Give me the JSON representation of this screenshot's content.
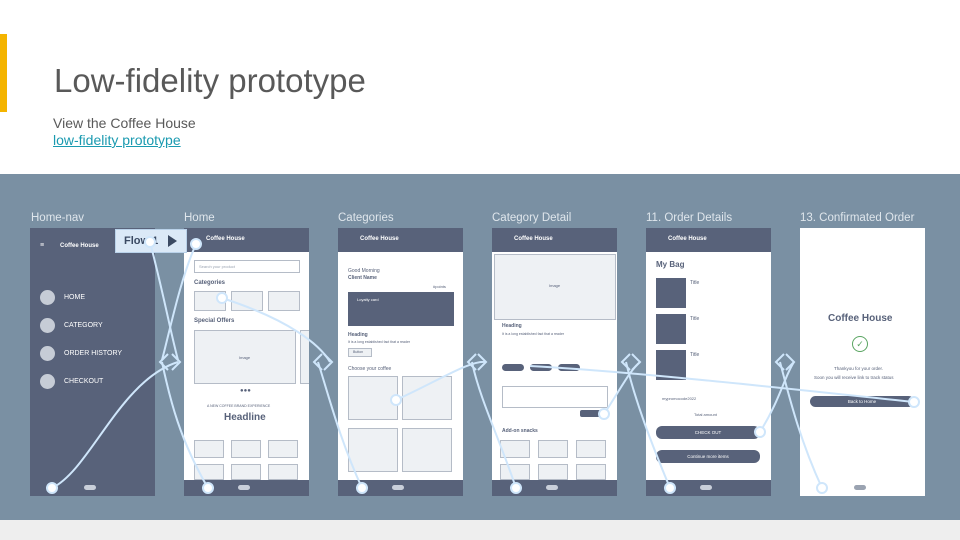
{
  "slide": {
    "title": "Low-fidelity prototype",
    "subtitle_line1": "View the Coffee House",
    "subtitle_link": "low-fidelity prototype",
    "accent_color": "#f4b400",
    "band_color": "#7a90a3",
    "link_color": "#1a9ab0"
  },
  "flow": {
    "label": "Flow 1"
  },
  "screens": [
    {
      "label": "Home-nav"
    },
    {
      "label": "Home"
    },
    {
      "label": "Categories"
    },
    {
      "label": "Category Detail"
    },
    {
      "label": "11. Order Details"
    },
    {
      "label": "13. Confirmated Order"
    }
  ],
  "home_nav": {
    "app_title": "Coffee House",
    "items": [
      "HOME",
      "CATEGORY",
      "ORDER HISTORY",
      "CHECKOUT"
    ]
  },
  "home": {
    "app_title": "Coffee House",
    "search_placeholder": "Search your product",
    "categories_heading": "Categories",
    "special_offers": "Special Offers",
    "image_label": "Image",
    "tagline": "A NEW COFFEE BRAND EXPERIENCE",
    "headline": "Headline"
  },
  "categories": {
    "app_title": "Coffee House",
    "greeting": "Good Morning",
    "client": "Client Name",
    "points": "#points",
    "loyalty": "Loyalty card",
    "heading": "Heading",
    "body": "It is a long established fact that a reader",
    "button": "Button",
    "choose": "Choose your coffee"
  },
  "category_detail": {
    "app_title": "Coffee House",
    "image_label": "Image",
    "heading": "Heading",
    "body": "It is a long established fact that a reader",
    "add_on": "Add-on snacks",
    "image_small": "Image"
  },
  "order_details": {
    "app_title": "Coffee House",
    "my_bag": "My Bag",
    "item_title": "Title",
    "promo": "mypromocode2022",
    "total": "Total amount",
    "checkout": "CHECK OUT",
    "continue": "Continue more items"
  },
  "confirmed": {
    "brand": "Coffee House",
    "thanks": "Thankyou for your order.",
    "status": "Soon you will receive link to track status",
    "back": "Back to Home"
  }
}
